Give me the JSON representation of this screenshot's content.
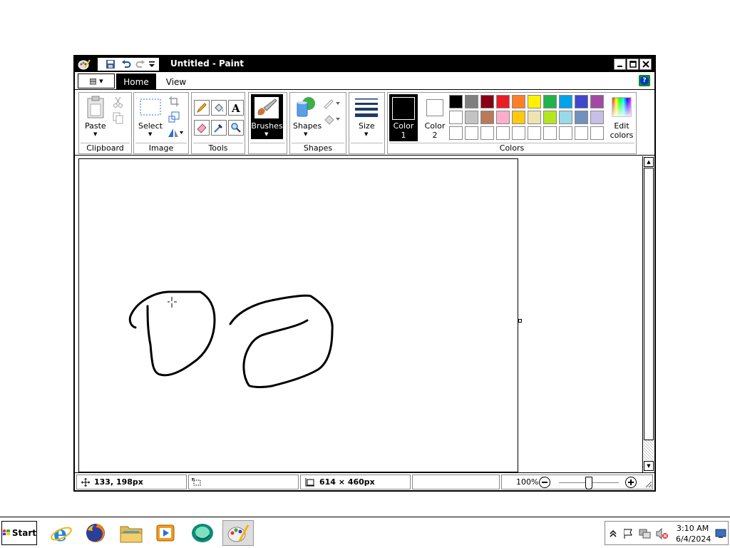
{
  "window": {
    "title": "Untitled - Paint",
    "controls": {
      "minimize": "_",
      "maximize": "□",
      "close": "X"
    }
  },
  "tabs": {
    "file": "▤ ▾",
    "home": "Home",
    "view": "View",
    "help": "?"
  },
  "ribbon": {
    "clipboard": {
      "paste": "Paste",
      "group": "Clipboard"
    },
    "image": {
      "select": "Select",
      "group": "Image"
    },
    "tools": {
      "group": "Tools"
    },
    "brushes": {
      "label": "Brushes"
    },
    "shapes": {
      "label": "Shapes",
      "group": "Shapes"
    },
    "size": {
      "label": "Size"
    },
    "colors": {
      "color1_line1": "Color",
      "color1_line2": "1",
      "color2_line1": "Color",
      "color2_line2": "2",
      "edit_line1": "Edit",
      "edit_line2": "colors",
      "group": "Colors",
      "row1": [
        "#000000",
        "#7f7f7f",
        "#880015",
        "#ed1c24",
        "#ff7f27",
        "#fff200",
        "#22b14c",
        "#00a2e8",
        "#3f48cc",
        "#a349a4"
      ],
      "row2": [
        "#ffffff",
        "#c3c3c3",
        "#b97a57",
        "#ffaec9",
        "#ffc90e",
        "#efe4b0",
        "#b5e61d",
        "#99d9ea",
        "#7092be",
        "#c8bfe7"
      ],
      "row3": [
        "#ffffff",
        "#ffffff",
        "#ffffff",
        "#ffffff",
        "#ffffff",
        "#ffffff",
        "#ffffff",
        "#ffffff",
        "#ffffff",
        "#ffffff"
      ],
      "color1": "#000000",
      "color2": "#ffffff"
    }
  },
  "status": {
    "cursor_pos": "133, 198px",
    "canvas_size": "614 × 460px",
    "zoom": "100%"
  },
  "taskbar": {
    "start": "Start",
    "time": "3:10 AM",
    "date": "6/4/2024"
  }
}
